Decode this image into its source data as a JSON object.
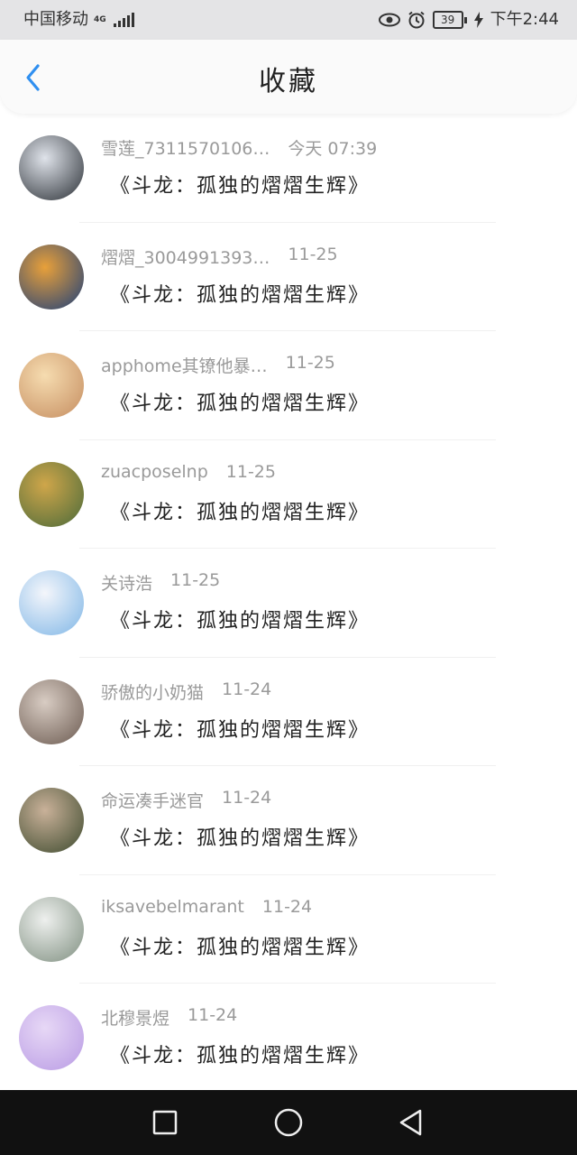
{
  "status_bar": {
    "carrier": "中国移动",
    "network": "4G",
    "battery": "39",
    "time": "下午2:44"
  },
  "header": {
    "title": "收藏",
    "back_icon": "chevron-left-icon"
  },
  "favorites": [
    {
      "user": "雪莲_7311570106…",
      "date": "今天 07:39",
      "book": "《斗龙：孤独的熠熠生辉》",
      "colors": [
        "#dfe3ea",
        "#2b3036"
      ]
    },
    {
      "user": "熠熠_3004991393…",
      "date": "11-25",
      "book": "《斗龙：孤独的熠熠生辉》",
      "colors": [
        "#e8a03a",
        "#1d3f7a"
      ]
    },
    {
      "user": "apphome其镣他暴…",
      "date": "11-25",
      "book": "《斗龙：孤独的熠熠生辉》",
      "colors": [
        "#f6dcb0",
        "#c58d60"
      ]
    },
    {
      "user": "zuacposelnp",
      "date": "11-25",
      "book": "《斗龙：孤独的熠熠生辉》",
      "colors": [
        "#cfa64a",
        "#4a6a3a"
      ]
    },
    {
      "user": "关诗浩",
      "date": "11-25",
      "book": "《斗龙：孤独的熠熠生辉》",
      "colors": [
        "#f4f6fb",
        "#7fb6e6"
      ]
    },
    {
      "user": "骄傲的小奶猫",
      "date": "11-24",
      "book": "《斗龙：孤独的熠熠生辉》",
      "colors": [
        "#d8ccc3",
        "#6b5a50"
      ]
    },
    {
      "user": "命运凑手迷官",
      "date": "11-24",
      "book": "《斗龙：孤独的熠熠生辉》",
      "colors": [
        "#c9b199",
        "#3d4a2e"
      ]
    },
    {
      "user": "iksavebelmarant",
      "date": "11-24",
      "book": "《斗龙：孤独的熠熠生辉》",
      "colors": [
        "#eef0ee",
        "#7f8f80"
      ]
    },
    {
      "user": "北穆景煜",
      "date": "11-24",
      "book": "《斗龙：孤独的熠熠生辉》",
      "colors": [
        "#e7d8f6",
        "#b99be4"
      ]
    }
  ],
  "nav_bar": {
    "recent_icon": "square-icon",
    "home_icon": "circle-icon",
    "back_icon": "triangle-back-icon"
  }
}
